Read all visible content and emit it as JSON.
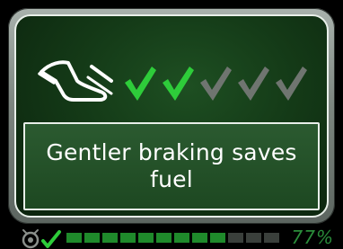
{
  "message": {
    "text": "Gentler braking saves fuel"
  },
  "icons": {
    "brake": "brake-pedal-foot-icon",
    "check": "checkmark-icon",
    "status": "eco-indicator-icon"
  },
  "rating": {
    "earned": 2,
    "total": 5
  },
  "progress": {
    "filled": 9,
    "total": 12,
    "percent_label": "77%"
  },
  "colors": {
    "check_active": "#2ecc3a",
    "check_inactive": "#6f7570",
    "progress_filled": "#1f8a2b",
    "progress_empty": "#3a3f3b",
    "percent_text": "#2a8c3a",
    "panel_bg": "#143a17",
    "message_bg": "#245228"
  }
}
